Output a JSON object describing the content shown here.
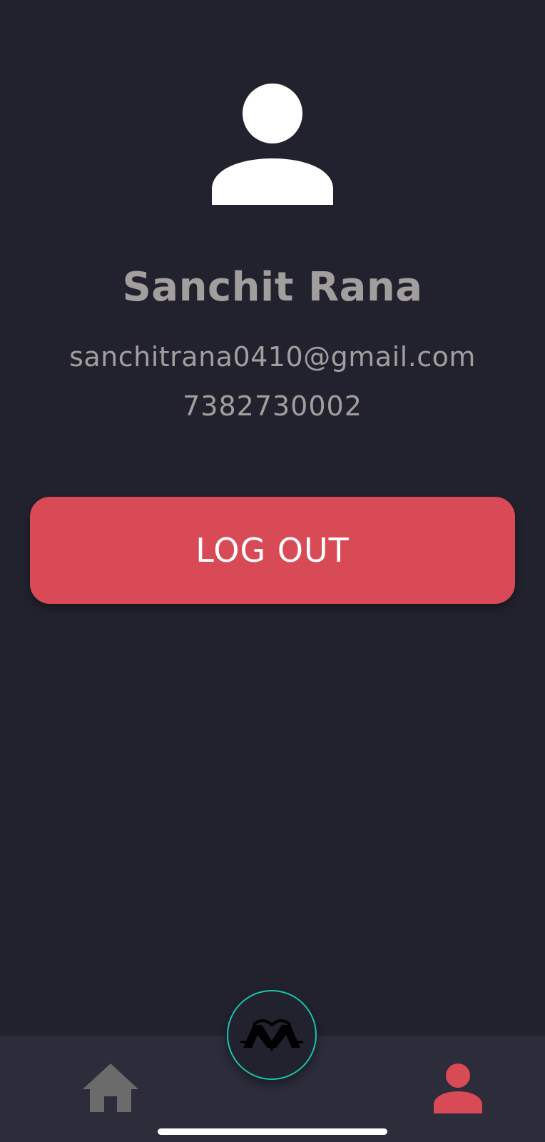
{
  "profile": {
    "avatar_icon": "user-icon",
    "name": "Sanchit Rana",
    "email": "sanchitrana0410@gmail.com",
    "phone": "7382730002"
  },
  "actions": {
    "logout_label": "LOG OUT"
  },
  "bottom_nav": {
    "items": [
      {
        "id": "home",
        "icon": "home-icon",
        "active": false
      },
      {
        "id": "center",
        "icon": "app-logo-icon",
        "active": false
      },
      {
        "id": "profile",
        "icon": "user-icon",
        "active": true
      }
    ]
  },
  "colors": {
    "background": "#22222e",
    "nav_background": "#2c2c3a",
    "accent": "#d84b56",
    "text_muted": "#a39e9e",
    "fab_ring": "#19c2b0",
    "inactive_icon": "#6b6b6b"
  }
}
